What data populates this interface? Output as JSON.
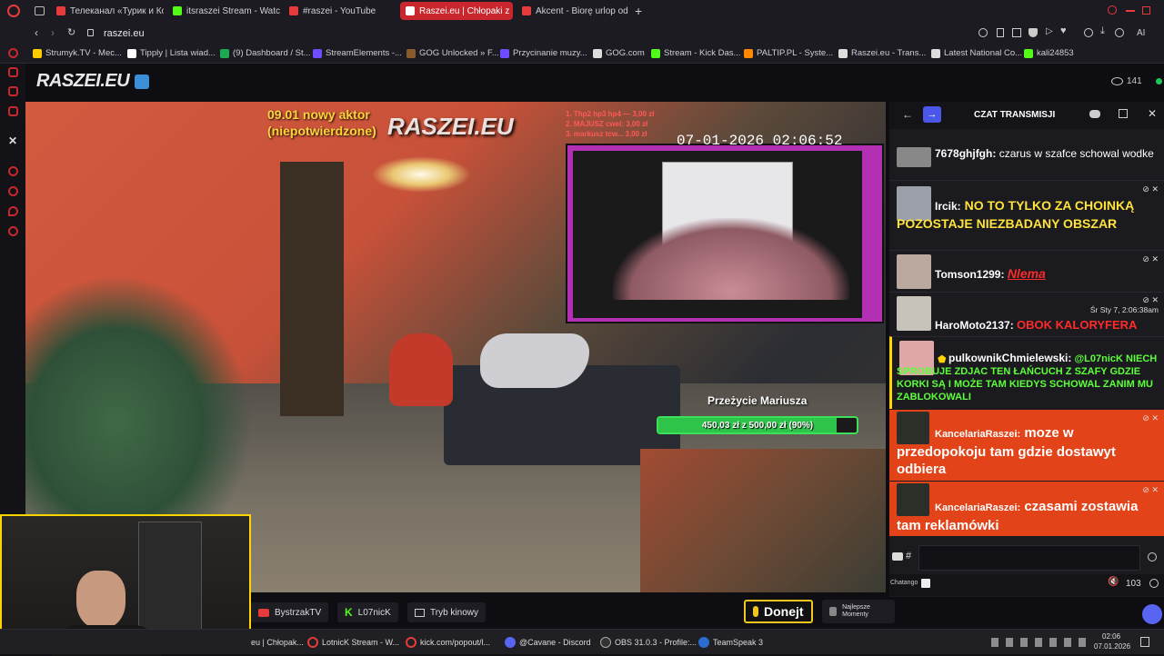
{
  "browser": {
    "tabs": [
      {
        "label": "Телеканал «Турик и Кони",
        "active": false,
        "color": "#e63b3b"
      },
      {
        "label": "itsraszei Stream - Watch L",
        "active": false,
        "color": "#53fc18"
      },
      {
        "label": "#raszei - YouTube",
        "active": false,
        "color": "#e63b3b"
      },
      {
        "label": "Raszei.eu | Chłopaki z",
        "active": true,
        "color": "#ffffff"
      },
      {
        "label": "Akcent - Biorę urlop od Ci",
        "active": false,
        "color": "#e63b3b"
      }
    ],
    "new_tab": "+",
    "url": "raszei.eu",
    "bookmarks": [
      {
        "label": "Strumyk.TV - Mec...",
        "color": "#ffcc00"
      },
      {
        "label": "Tipply | Lista wiad...",
        "color": "#ffffff"
      },
      {
        "label": "(9) Dashboard / St...",
        "color": "#1da851"
      },
      {
        "label": "StreamElements -...",
        "color": "#6f4cff"
      },
      {
        "label": "GOG Unlocked » F...",
        "color": "#8b5a2b"
      },
      {
        "label": "Przycinanie muzy...",
        "color": "#6f4cff"
      },
      {
        "label": "GOG.com",
        "color": "#dddddd"
      },
      {
        "label": "Stream - Kick Das...",
        "color": "#53fc18"
      },
      {
        "label": "PALTIP.PL - Syste...",
        "color": "#ff8800"
      },
      {
        "label": "Raszei.eu - Trans...",
        "color": "#dddddd"
      },
      {
        "label": "Latest National Co...",
        "color": "#dddddd"
      },
      {
        "label": "kali24853",
        "color": "#53fc18"
      }
    ],
    "ai_label": "AI"
  },
  "site": {
    "logo": "RASZEI.EU",
    "viewers": "141",
    "video_overlay": {
      "actor_note_1": "09.01 nowy aktor",
      "actor_note_2": "(niepotwierdzone)",
      "watermark": "RASZEI.EU",
      "top_list": [
        "1. Thp2 hp3 hp4 — 3,00 zł",
        "2. MAJUSZ cwel: 3,00 zł",
        "3. markusz tcw... 3,00 zł"
      ],
      "timestamp": "07-01-2026 02:06:52",
      "goal_label": "Przeżycie Mariusza",
      "goal_progress": "450,03 zł z 500,00 zł (90%)",
      "goal_fraction": 0.9
    },
    "bottom": {
      "channel_1": "BystrzakTV",
      "channel_2": "L07nicK",
      "cinema_mode": "Tryb kinowy",
      "donate": "Donejt",
      "moments": "Najlepsze Momenty"
    }
  },
  "chat": {
    "title": "CZAT TRANSMISJI",
    "messages": [
      {
        "user": "7678ghjfgh:",
        "text": "czarus w szafce schowal wodke",
        "text_color": "#ffffff"
      },
      {
        "user": "Ircik:",
        "text": "NO TO TYLKO ZA CHOINKĄ POZOSTAJE NIEZBADANY OBSZAR",
        "text_color": "#ffe33b"
      },
      {
        "user": "Tomson1299:",
        "text": "Nlema",
        "text_color": "#ff2a2a"
      },
      {
        "user": "HaroMoto2137:",
        "text": "OBOK KALORYFERA",
        "text_color": "#ff2a2a",
        "time": "Śr Sty 7, 2:06:38am"
      },
      {
        "user": "pulkownikChmielewski:",
        "text": "@L07nicK NIECH SPROBUJE ZDJAC TEN ŁAŃCUCH Z SZAFY GDZIE KORKI SĄ I MOŻE TAM KIEDYS SCHOWAL ZANIM MU ZABLOKOWALI",
        "text_color": "#5dff3b"
      },
      {
        "user": "KancelariaRaszei:",
        "text": "moze w przedopokoju tam gdzie dostawyt odbiera",
        "text_color": "#ffffff"
      },
      {
        "user": "KancelariaRaszei:",
        "text": "czasami zostawia tam reklamówki",
        "text_color": "#ffffff"
      }
    ],
    "input_prefix": "#",
    "footer_label": "Chatango",
    "user_count": "103"
  },
  "taskbar": {
    "items": [
      {
        "label": "eu | Chłopak...",
        "color": "#e63b3b"
      },
      {
        "label": "LotnicK Stream - W...",
        "color": "#e63b3b"
      },
      {
        "label": "kick.com/popout/l...",
        "color": "#e63b3b"
      },
      {
        "label": "@Cavane - Discord",
        "color": "#5865f2"
      },
      {
        "label": "OBS 31.0.3 - Profile:...",
        "color": "#333333"
      },
      {
        "label": "TeamSpeak 3",
        "color": "#2b6ccf"
      }
    ],
    "time": "02:06",
    "date": "07.01.2026"
  }
}
